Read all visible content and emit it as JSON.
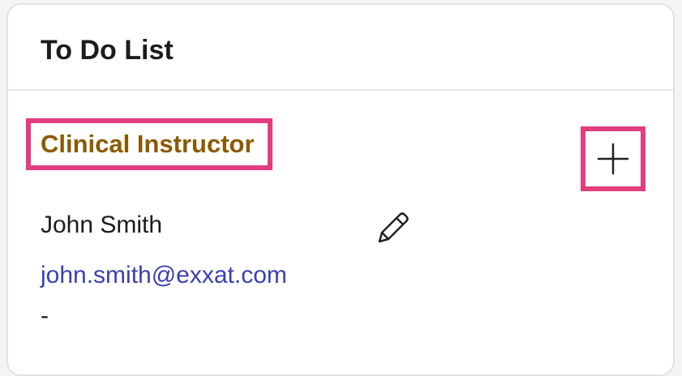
{
  "card": {
    "title": "To Do List"
  },
  "section": {
    "role_label": "Clinical Instructor",
    "add_icon": "plus-icon",
    "contact": {
      "name": "John Smith",
      "edit_icon": "pencil-icon",
      "email": "john.smith@exxat.com",
      "phone": "-"
    }
  },
  "colors": {
    "role_label": "#8a5a00",
    "highlight": "#e23d7e",
    "email_link": "#3b3fb0"
  }
}
